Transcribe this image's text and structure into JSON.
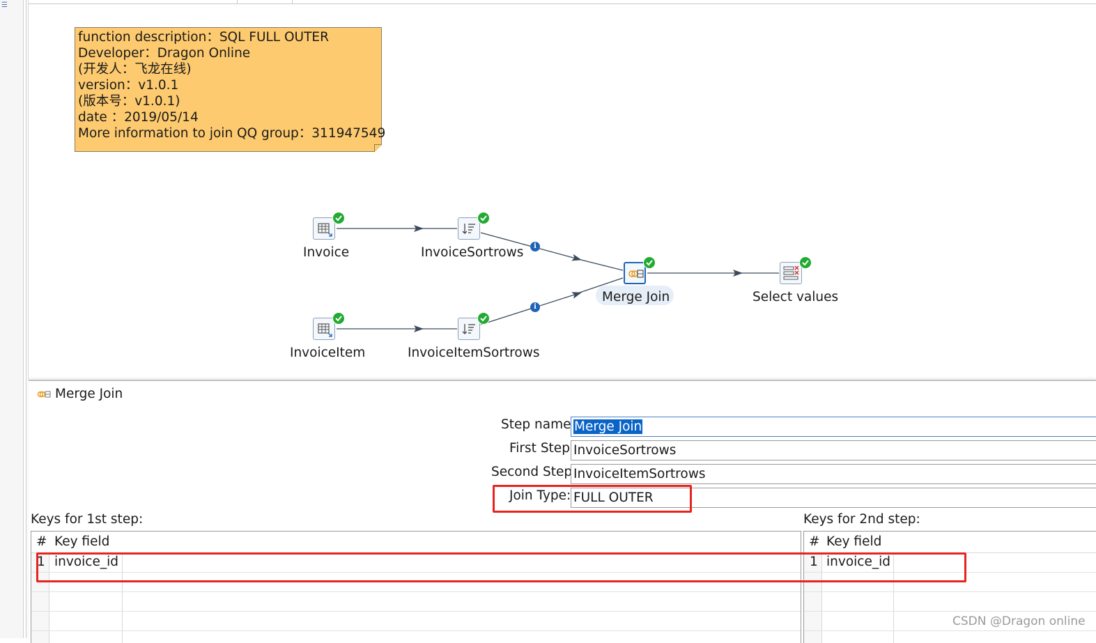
{
  "note": {
    "lines": [
      "function description：SQL FULL OUTER",
      "Developer：Dragon Online",
      "(开发人：飞龙在线)",
      "version：v1.0.1",
      "(版本号：v1.0.1)",
      "date ：2019/05/14",
      "More information to join QQ group：311947549"
    ]
  },
  "canvas": {
    "steps": [
      {
        "id": "invoice",
        "label": "Invoice",
        "icon": "table-input-icon",
        "status": "ok"
      },
      {
        "id": "invoice_sortrows",
        "label": "InvoiceSortrows",
        "icon": "sort-rows-icon",
        "status": "ok"
      },
      {
        "id": "invoiceitem",
        "label": "InvoiceItem",
        "icon": "table-input-icon",
        "status": "ok"
      },
      {
        "id": "invoiceitem_sortrows",
        "label": "InvoiceItemSortrows",
        "icon": "sort-rows-icon",
        "status": "ok"
      },
      {
        "id": "merge_join",
        "label": "Merge Join",
        "icon": "merge-join-icon",
        "status": "ok",
        "selected": true
      },
      {
        "id": "select_values",
        "label": "Select values",
        "icon": "select-values-icon",
        "status": "ok"
      }
    ],
    "hops": [
      {
        "from": "invoice",
        "to": "invoice_sortrows"
      },
      {
        "from": "invoice_sortrows",
        "to": "merge_join",
        "info": "i"
      },
      {
        "from": "invoiceitem",
        "to": "invoiceitem_sortrows"
      },
      {
        "from": "invoiceitem_sortrows",
        "to": "merge_join",
        "info": "i"
      },
      {
        "from": "merge_join",
        "to": "select_values"
      }
    ]
  },
  "dialog": {
    "title": "Merge Join",
    "icon": "merge-join-icon",
    "step_name_label": "Step name",
    "step_name_value": "Merge Join",
    "first_step_label": "First Step:",
    "first_step_value": "InvoiceSortrows",
    "second_step_label": "Second Step:",
    "second_step_value": "InvoiceItemSortrows",
    "join_type_label": "Join Type:",
    "join_type_value": "FULL OUTER",
    "keys1": {
      "label": "Keys for 1st step:",
      "header": {
        "num": "#",
        "field": "Key field"
      },
      "rows": [
        {
          "num": "1",
          "field": "invoice_id"
        }
      ]
    },
    "keys2": {
      "label": "Keys for 2nd step:",
      "header": {
        "num": "#",
        "field": "Key field"
      },
      "rows": [
        {
          "num": "1",
          "field": "invoice_id"
        }
      ]
    }
  },
  "colors": {
    "note_bg": "#fdca6f",
    "ok_badge": "#22aa33",
    "highlight_box": "#e8231f",
    "selection": "#0a64c8"
  },
  "watermark": "CSDN @Dragon online"
}
